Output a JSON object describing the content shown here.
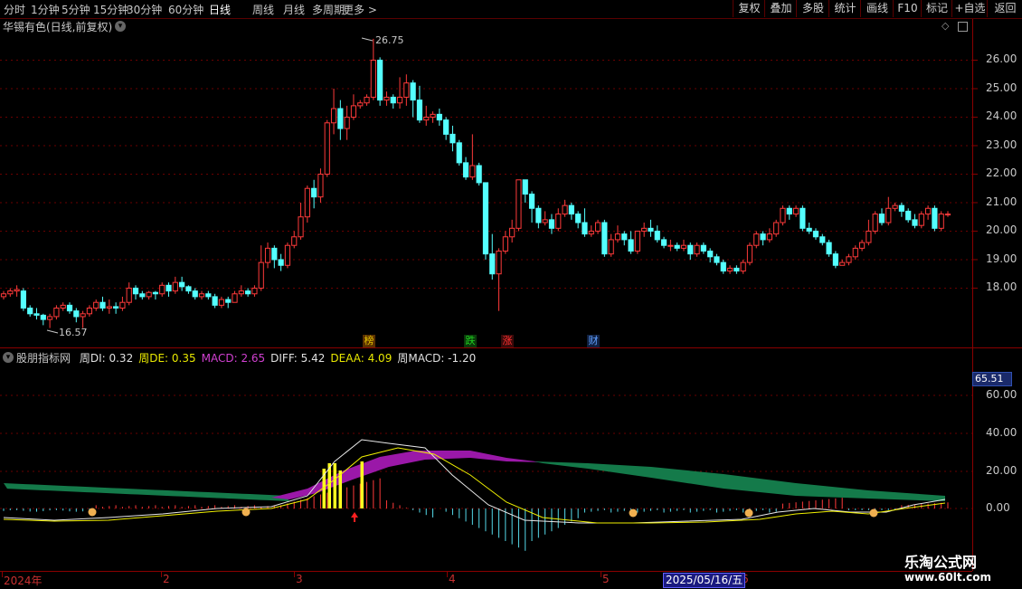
{
  "toolbar": {
    "periods": [
      "分时",
      "1分钟",
      "5分钟",
      "15分钟",
      "30分钟",
      "60分钟",
      "日线",
      "周线",
      "月线",
      "多周期",
      "更多 >"
    ],
    "active_period": "日线",
    "right_buttons": [
      "复权",
      "叠加",
      "多股",
      "统计",
      "画线",
      "F10",
      "标记",
      "+自选",
      "返回"
    ]
  },
  "chart_title": "华锡有色(日线,前复权)",
  "price_axis": [
    "26.00",
    "25.00",
    "24.00",
    "23.00",
    "22.00",
    "21.00",
    "20.00",
    "19.00",
    "18.00"
  ],
  "annotations": {
    "high": "26.75",
    "low": "16.57"
  },
  "event_markers": [
    {
      "label": "榜",
      "color": "#e0c000",
      "bg": "#5a3000"
    },
    {
      "label": "跌",
      "color": "#20d020",
      "bg": "#0a3a0a"
    },
    {
      "label": "涨",
      "color": "#ff3030",
      "bg": "#3a0a0a"
    },
    {
      "label": "财",
      "color": "#60a0ff",
      "bg": "#102040"
    }
  ],
  "indicator": {
    "name": "股朋指标网",
    "items": [
      {
        "text": "周DI: 0.32",
        "color": "#e0e0e0"
      },
      {
        "text": "周DE: 0.35",
        "color": "#e8e800"
      },
      {
        "text": "MACD: 2.65",
        "color": "#d040d0"
      },
      {
        "text": "DIFF: 5.42",
        "color": "#e0e0e0"
      },
      {
        "text": "DEAA: 4.09",
        "color": "#e8e800"
      },
      {
        "text": "周MACD: -1.20",
        "color": "#e0e0e0"
      }
    ]
  },
  "indicator_axis": [
    "60.00",
    "40.00",
    "20.00",
    "0.00"
  ],
  "indicator_badge": "65.51",
  "date_axis": [
    "2024年",
    "2",
    "3",
    "4",
    "5",
    "6"
  ],
  "current_date": "2025/05/16/五",
  "watermark": {
    "line1": "乐淘公式网",
    "line2": "www.60lt.com"
  },
  "colors": {
    "up": "#ff3a3a",
    "down": "#54ffff",
    "axis": "#8a0000",
    "bg": "#000000"
  },
  "chart_data": {
    "type": "candlestick",
    "ylim": [
      16.3,
      27.0
    ],
    "candles": [
      [
        17.7,
        17.8,
        17.6,
        17.9
      ],
      [
        17.8,
        17.9,
        17.7,
        18.0
      ],
      [
        17.9,
        17.95,
        17.7,
        18.1
      ],
      [
        17.9,
        17.3,
        17.2,
        18.0
      ],
      [
        17.3,
        17.1,
        17.0,
        17.4
      ],
      [
        17.1,
        17.05,
        16.9,
        17.3
      ],
      [
        17.05,
        16.9,
        16.7,
        17.1
      ],
      [
        16.9,
        17.0,
        16.6,
        17.1
      ],
      [
        17.0,
        17.3,
        16.9,
        17.4
      ],
      [
        17.3,
        17.4,
        17.2,
        17.5
      ],
      [
        17.4,
        17.2,
        17.1,
        17.5
      ],
      [
        17.2,
        17.0,
        16.8,
        17.3
      ],
      [
        17.0,
        17.1,
        16.6,
        17.2
      ],
      [
        17.1,
        17.3,
        17.0,
        17.4
      ],
      [
        17.3,
        17.5,
        17.2,
        17.6
      ],
      [
        17.5,
        17.3,
        17.2,
        17.7
      ],
      [
        17.3,
        17.35,
        17.1,
        17.6
      ],
      [
        17.35,
        17.3,
        17.1,
        17.5
      ],
      [
        17.3,
        17.5,
        17.2,
        17.7
      ],
      [
        17.5,
        18.0,
        17.4,
        18.2
      ],
      [
        18.0,
        17.8,
        17.6,
        18.1
      ],
      [
        17.8,
        17.7,
        17.6,
        17.9
      ],
      [
        17.7,
        17.85,
        17.6,
        17.9
      ],
      [
        17.85,
        17.8,
        17.6,
        17.9
      ],
      [
        17.8,
        18.1,
        17.7,
        18.2
      ],
      [
        18.1,
        17.9,
        17.7,
        18.2
      ],
      [
        17.9,
        18.2,
        17.8,
        18.4
      ],
      [
        18.2,
        18.05,
        17.9,
        18.4
      ],
      [
        18.05,
        17.9,
        17.8,
        18.1
      ],
      [
        17.9,
        17.7,
        17.6,
        18.0
      ],
      [
        17.7,
        17.8,
        17.6,
        17.9
      ],
      [
        17.8,
        17.7,
        17.6,
        17.9
      ],
      [
        17.7,
        17.4,
        17.3,
        17.8
      ],
      [
        17.4,
        17.6,
        17.3,
        17.7
      ],
      [
        17.6,
        17.5,
        17.3,
        17.7
      ],
      [
        17.5,
        17.8,
        17.5,
        17.9
      ],
      [
        17.8,
        17.9,
        17.7,
        18.1
      ],
      [
        17.9,
        17.8,
        17.7,
        18.0
      ],
      [
        17.8,
        18.0,
        17.7,
        18.1
      ],
      [
        18.0,
        18.9,
        17.9,
        19.5
      ],
      [
        18.9,
        19.4,
        18.7,
        19.6
      ],
      [
        19.4,
        19.0,
        18.7,
        19.5
      ],
      [
        19.0,
        18.8,
        18.6,
        19.2
      ],
      [
        18.8,
        19.5,
        18.7,
        19.6
      ],
      [
        19.5,
        19.8,
        19.4,
        20.0
      ],
      [
        19.8,
        20.5,
        19.7,
        21.0
      ],
      [
        20.5,
        21.5,
        20.3,
        21.6
      ],
      [
        21.5,
        21.2,
        20.8,
        21.8
      ],
      [
        21.2,
        22.0,
        21.0,
        22.2
      ],
      [
        22.0,
        23.8,
        21.9,
        23.9
      ],
      [
        23.8,
        24.3,
        23.4,
        25.0
      ],
      [
        24.3,
        23.6,
        23.2,
        24.6
      ],
      [
        23.6,
        24.0,
        23.2,
        24.4
      ],
      [
        24.0,
        24.4,
        23.9,
        24.8
      ],
      [
        24.4,
        24.5,
        24.3,
        24.6
      ],
      [
        24.5,
        24.7,
        24.4,
        24.8
      ],
      [
        24.7,
        26.0,
        24.6,
        26.75
      ],
      [
        26.0,
        24.6,
        24.4,
        26.1
      ],
      [
        24.6,
        24.7,
        24.4,
        24.9
      ],
      [
        24.7,
        24.5,
        24.3,
        24.8
      ],
      [
        24.5,
        24.7,
        24.3,
        25.4
      ],
      [
        24.7,
        25.2,
        24.4,
        25.5
      ],
      [
        25.2,
        24.6,
        24.0,
        25.3
      ],
      [
        24.6,
        23.9,
        23.8,
        25.1
      ],
      [
        23.9,
        24.0,
        23.7,
        24.4
      ],
      [
        24.0,
        24.1,
        23.8,
        24.2
      ],
      [
        24.1,
        23.9,
        23.7,
        24.3
      ],
      [
        23.9,
        23.4,
        23.2,
        24.0
      ],
      [
        23.4,
        23.1,
        22.8,
        23.7
      ],
      [
        23.1,
        22.4,
        22.3,
        23.2
      ],
      [
        22.4,
        21.9,
        21.8,
        22.6
      ],
      [
        21.9,
        22.3,
        21.8,
        23.4
      ],
      [
        22.3,
        21.7,
        21.6,
        22.4
      ],
      [
        21.7,
        19.2,
        19.0,
        20.5
      ],
      [
        19.2,
        18.5,
        18.3,
        19.9
      ],
      [
        18.5,
        19.3,
        17.2,
        19.4
      ],
      [
        19.3,
        19.8,
        19.2,
        20.0
      ],
      [
        19.8,
        20.1,
        19.6,
        20.4
      ],
      [
        20.1,
        21.8,
        20.0,
        21.8
      ],
      [
        21.8,
        21.3,
        21.0,
        21.8
      ],
      [
        21.3,
        20.8,
        20.3,
        21.4
      ],
      [
        20.8,
        20.3,
        20.1,
        20.9
      ],
      [
        20.3,
        20.4,
        20.2,
        20.7
      ],
      [
        20.4,
        20.1,
        19.9,
        20.6
      ],
      [
        20.1,
        20.6,
        20.0,
        20.8
      ],
      [
        20.6,
        20.9,
        20.5,
        21.1
      ],
      [
        20.9,
        20.6,
        20.4,
        21.0
      ],
      [
        20.6,
        20.3,
        20.1,
        20.7
      ],
      [
        20.3,
        19.9,
        19.8,
        20.8
      ],
      [
        19.9,
        20.0,
        19.8,
        20.2
      ],
      [
        20.0,
        20.3,
        19.9,
        20.4
      ],
      [
        20.3,
        19.2,
        19.1,
        20.4
      ],
      [
        19.2,
        19.7,
        19.1,
        19.9
      ],
      [
        19.7,
        19.9,
        19.6,
        20.2
      ],
      [
        19.9,
        19.7,
        19.5,
        20.0
      ],
      [
        19.7,
        19.3,
        19.2,
        20.0
      ],
      [
        19.3,
        20.0,
        19.2,
        20.0
      ],
      [
        20.0,
        20.1,
        19.8,
        20.3
      ],
      [
        20.1,
        20.0,
        19.8,
        20.4
      ],
      [
        20.0,
        19.7,
        19.6,
        20.2
      ],
      [
        19.7,
        19.5,
        19.4,
        19.8
      ],
      [
        19.5,
        19.5,
        19.3,
        19.7
      ],
      [
        19.5,
        19.4,
        19.3,
        19.6
      ],
      [
        19.4,
        19.5,
        19.3,
        19.7
      ],
      [
        19.5,
        19.2,
        19.0,
        19.6
      ],
      [
        19.2,
        19.5,
        19.1,
        19.6
      ],
      [
        19.5,
        19.3,
        19.2,
        19.6
      ],
      [
        19.3,
        19.1,
        18.9,
        19.4
      ],
      [
        19.1,
        18.9,
        18.8,
        19.2
      ],
      [
        18.9,
        18.6,
        18.5,
        19.0
      ],
      [
        18.6,
        18.7,
        18.5,
        18.8
      ],
      [
        18.7,
        18.6,
        18.5,
        18.8
      ],
      [
        18.6,
        18.9,
        18.5,
        19.0
      ],
      [
        18.9,
        19.5,
        18.8,
        19.6
      ],
      [
        19.5,
        19.9,
        19.4,
        20.0
      ],
      [
        19.9,
        19.7,
        19.5,
        20.0
      ],
      [
        19.7,
        19.9,
        19.6,
        20.1
      ],
      [
        19.9,
        20.3,
        19.8,
        20.4
      ],
      [
        20.3,
        20.8,
        20.2,
        20.9
      ],
      [
        20.8,
        20.6,
        20.4,
        20.9
      ],
      [
        20.6,
        20.8,
        20.5,
        20.9
      ],
      [
        20.8,
        20.1,
        20.0,
        20.9
      ],
      [
        20.1,
        20.0,
        19.9,
        20.3
      ],
      [
        20.0,
        19.8,
        19.7,
        20.1
      ],
      [
        19.8,
        19.6,
        19.5,
        19.9
      ],
      [
        19.6,
        19.2,
        19.1,
        19.7
      ],
      [
        19.2,
        18.8,
        18.7,
        19.3
      ],
      [
        18.8,
        18.9,
        18.8,
        19.0
      ],
      [
        18.9,
        19.1,
        18.8,
        19.2
      ],
      [
        19.1,
        19.4,
        19.0,
        19.5
      ],
      [
        19.4,
        19.6,
        19.3,
        19.7
      ],
      [
        19.6,
        20.0,
        19.5,
        20.4
      ],
      [
        20.0,
        20.6,
        19.9,
        20.7
      ],
      [
        20.6,
        20.3,
        20.2,
        20.8
      ],
      [
        20.3,
        20.8,
        20.2,
        21.2
      ],
      [
        20.8,
        20.9,
        20.7,
        21.0
      ],
      [
        20.9,
        20.7,
        20.5,
        21.0
      ],
      [
        20.7,
        20.4,
        20.3,
        20.8
      ],
      [
        20.4,
        20.2,
        20.1,
        20.6
      ],
      [
        20.2,
        20.6,
        20.1,
        20.7
      ],
      [
        20.6,
        20.8,
        20.4,
        20.9
      ],
      [
        20.8,
        20.1,
        20.0,
        20.9
      ],
      [
        20.1,
        20.6,
        20.0,
        20.7
      ],
      [
        20.6,
        20.6,
        20.5,
        20.7
      ]
    ]
  }
}
